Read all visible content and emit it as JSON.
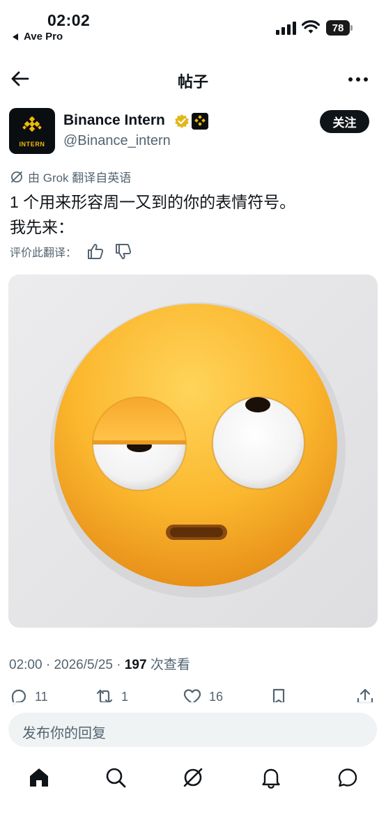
{
  "status_bar": {
    "time": "02:02",
    "back_app": "Ave Pro",
    "battery": "78"
  },
  "header": {
    "title": "帖子"
  },
  "author": {
    "name": "Binance Intern",
    "handle": "@Binance_intern",
    "avatar_text": "INTERN",
    "follow_label": "关注"
  },
  "translation": {
    "note": "由 Grok 翻译自英语",
    "text_line1": "1 个用来形容周一又到的你的表情符号。",
    "text_line2": "我先来：",
    "rate_label": "评价此翻译："
  },
  "meta": {
    "time": "02:00",
    "date": "2026/5/25",
    "views": "197",
    "views_label": "次查看"
  },
  "actions": {
    "replies": "11",
    "reposts": "1",
    "likes": "16"
  },
  "reply": {
    "placeholder": "发布你的回复"
  },
  "icons": {
    "accent_brand": "#f0b90b",
    "verified_color": "#e2b719"
  }
}
